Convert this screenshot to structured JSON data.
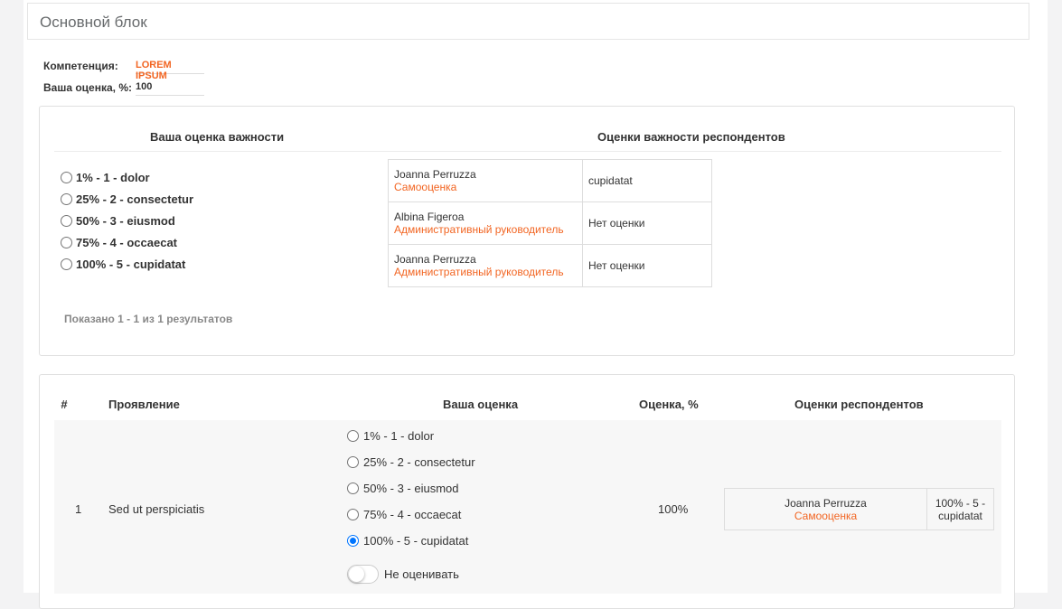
{
  "panel": {
    "title": "Основной блок"
  },
  "fields": {
    "competence_label": "Компетенция:",
    "competence_value": "LOREM IPSUM",
    "score_label": "Ваша оценка, %:",
    "score_value": "100"
  },
  "importance": {
    "your_header": "Ваша оценка важности",
    "resp_header": "Оценки важности респондентов",
    "options": [
      {
        "pct": "1%",
        "num": "1",
        "label": "dolor",
        "checked": false
      },
      {
        "pct": "25%",
        "num": "2",
        "label": "consectetur",
        "checked": false
      },
      {
        "pct": "50%",
        "num": "3",
        "label": "eiusmod",
        "checked": false
      },
      {
        "pct": "75%",
        "num": "4",
        "label": "occaecat",
        "checked": false
      },
      {
        "pct": "100%",
        "num": "5",
        "label": "cupidatat",
        "checked": false
      }
    ],
    "respondents": [
      {
        "name": "Joanna Perruzza",
        "role": "Самооценка",
        "value": "cupidatat"
      },
      {
        "name": "Albina Figeroa",
        "role": "Административный руководитель",
        "value": "Нет оценки"
      },
      {
        "name": "Joanna Perruzza",
        "role": "Административный руководитель",
        "value": "Нет оценки"
      }
    ],
    "summary": "Показано 1 - 1 из 1 результатов"
  },
  "grid": {
    "headers": {
      "num": "#",
      "manifestation": "Проявление",
      "your_score": "Ваша оценка",
      "score_pct": "Оценка, %",
      "resp": "Оценки респондентов"
    },
    "rows": [
      {
        "num": "1",
        "manifestation": "Sed ut perspiciatis",
        "options": [
          {
            "text": "1% - 1 - dolor",
            "checked": false
          },
          {
            "text": "25% - 2 - consectetur",
            "checked": false
          },
          {
            "text": "50% - 3 - eiusmod",
            "checked": false
          },
          {
            "text": "75% - 4 - occaecat",
            "checked": false
          },
          {
            "text": "100% - 5 - cupidatat",
            "checked": true
          }
        ],
        "toggle_label": "Не оценивать",
        "score_pct": "100%",
        "respondent": {
          "name": "Joanna Perruzza",
          "role": "Самооценка",
          "value_line1": "100% - 5 -",
          "value_line2": "cupidatat"
        }
      }
    ]
  },
  "colors": {
    "accent": "#f26522",
    "radio_checked": "#0075ff"
  }
}
